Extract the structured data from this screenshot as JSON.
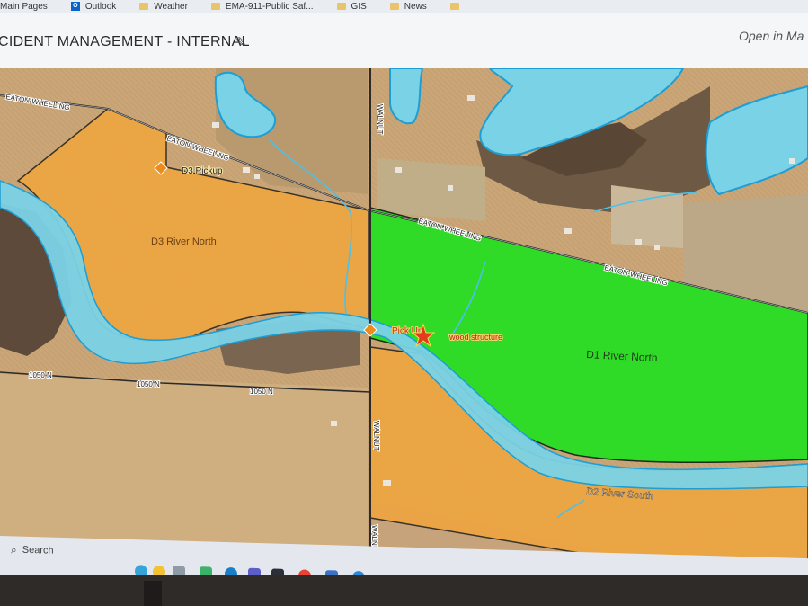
{
  "bookmarks": [
    "Main Pages",
    "Outlook",
    "Weather",
    "EMA-911-Public Saf...",
    "GIS",
    "News"
  ],
  "header": {
    "title": "CIDENT MANAGEMENT - INTERNAL",
    "open_in": "Open in Ma"
  },
  "map": {
    "roads": {
      "eaton_wheeling": "EATON-WHEELING",
      "walnut": "WALNUT",
      "n1050": "1050 N"
    },
    "zones": {
      "d3": "D3 River North",
      "d1": "D1 River North",
      "d2": "D2 River South"
    },
    "markers": {
      "d3_pickup": "D3 Pickup",
      "pickup": "Pick Up",
      "wood": "wood structure"
    },
    "colors": {
      "orange_zone": "#f0a43c",
      "green_zone": "#22e01f",
      "river": "#7ad2e6"
    }
  },
  "taskbar": {
    "search_placeholder": "Search"
  }
}
